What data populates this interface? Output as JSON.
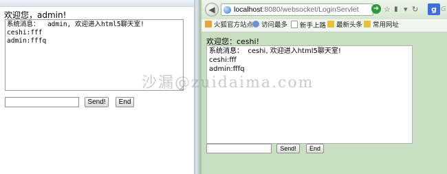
{
  "left_window": {
    "welcome": "欢迎您，admin!",
    "messages": [
      "系统消息：  admin, 欢迎进入html5聊天室!",
      "ceshi:fff",
      "admin:fffq"
    ],
    "send_label": "Send!",
    "end_label": "End"
  },
  "right_window": {
    "url_host": "localhost",
    "url_rest": ":8080/websocket/LoginServlet",
    "search_hint": "G",
    "bookmarks": [
      "火狐官方站点",
      "访问最多",
      "新手上路",
      "最新头条",
      "常用网址"
    ],
    "welcome": "欢迎您：ceshi!",
    "messages": [
      "系统消息：  ceshi, 欢迎进入html5聊天室!",
      "ceshi:fff",
      "admin:fffq"
    ],
    "send_label": "Send!",
    "end_label": "End"
  },
  "watermark": "沙漏@zuidaima.com",
  "colors": {
    "browser_bg": "#c9dfc2",
    "go_button": "#2c9b3a",
    "search_engine": "#3c6fd8"
  },
  "icons": [
    "back-arrow-icon",
    "globe-icon",
    "go-arrow-icon",
    "star-icon",
    "refresh-icon",
    "google-icon"
  ]
}
